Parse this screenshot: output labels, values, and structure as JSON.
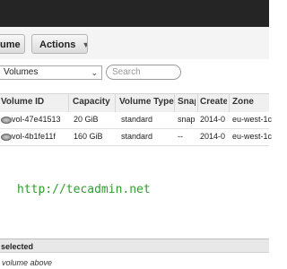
{
  "toolbar": {
    "volume_button": "ume",
    "actions_button": "Actions"
  },
  "filter": {
    "selected": "Volumes",
    "search_placeholder": "Search"
  },
  "table": {
    "headers": [
      "Volume ID",
      "Capacity",
      "Volume Type",
      "Snap",
      "Create",
      "Zone"
    ],
    "rows": [
      [
        "vol-47e41513",
        "20 GiB",
        "standard",
        "snap",
        "2014-0",
        "eu-west-1c"
      ],
      [
        "vol-4b1fe11f",
        "160 GiB",
        "standard",
        "--",
        "2014-0",
        "eu-west-1c"
      ]
    ]
  },
  "watermark": "http://tecadmin.net",
  "details": {
    "selected_label": "selected",
    "hint": "volume above"
  },
  "colors": {
    "topbar": "#252525",
    "watermark": "#2e9c2e"
  }
}
